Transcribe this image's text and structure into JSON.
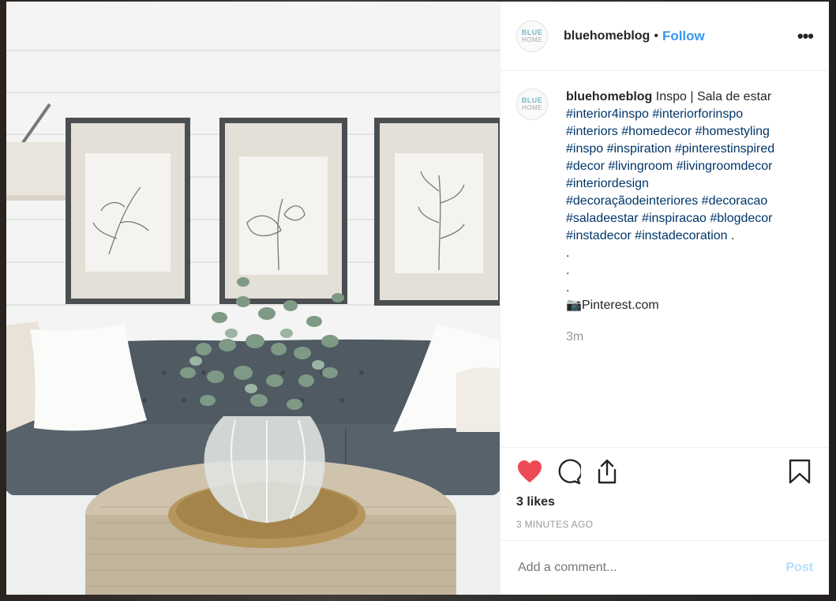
{
  "header": {
    "username": "bluehomeblog",
    "separator": "•",
    "follow_label": "Follow",
    "more_label": "•••",
    "avatar_line1": "BLUE",
    "avatar_line2": "HOME"
  },
  "caption": {
    "username": "bluehomeblog",
    "text": " Inspo | Sala de estar",
    "tags_line1": "#interior4inspo #interiorforinspo",
    "tags_line2": "#interiors #homedecor #homestyling",
    "tags_line3": "#inspo #inspiration #pinterestinspired",
    "tags_line4": "#decor #livingroom #livingroomdecor",
    "tags_line5": "#interiordesign",
    "tags_line6": "#decoraçãodeinteriores #decoracao",
    "tags_line7": "#saladeestar #inspiracao #blogdecor",
    "tags_line8_tags": "#instadecor #instadecoration",
    "tags_line8_end": " .",
    "dot1": ".",
    "dot2": ".",
    "dot3": ".",
    "source_icon": "📷",
    "source": "Pinterest.com",
    "time_ago": "3m"
  },
  "actions": {
    "like_icon": "heart-filled-red",
    "comment_icon": "speech-bubble",
    "share_icon": "share-upload",
    "save_icon": "bookmark",
    "likes_text": "3 likes",
    "posted_text": "3 MINUTES AGO"
  },
  "comment": {
    "placeholder": "Add a comment...",
    "post_label": "Post"
  },
  "colors": {
    "link": "#3897f0",
    "hashtag": "#003569",
    "like_red": "#ed4956",
    "post_disabled": "#b2dffc"
  }
}
